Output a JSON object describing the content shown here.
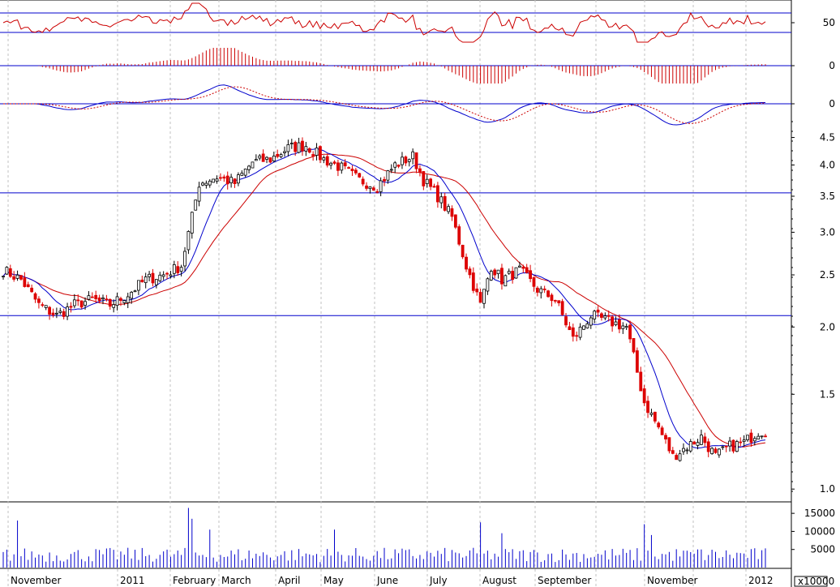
{
  "chart_data": {
    "type": "candlestick",
    "months": [
      "November",
      "2011",
      "February",
      "March",
      "April",
      "May",
      "June",
      "July",
      "August",
      "September",
      "",
      "November",
      "",
      "2012"
    ],
    "price_panel": {
      "scale": "log",
      "ylim": [
        0.95,
        4.9
      ],
      "yticks": [
        "1.0",
        "1.5",
        "2.0",
        "2.5",
        "3.0",
        "3.5",
        "4.0",
        "4.5"
      ],
      "tick_values": [
        1.0,
        1.5,
        2.0,
        2.5,
        3.0,
        3.5,
        4.0,
        4.5
      ],
      "support_lines": [
        3.55,
        2.1
      ],
      "close_keypoints": [
        [
          0,
          2.55
        ],
        [
          5,
          2.45
        ],
        [
          10,
          2.2
        ],
        [
          15,
          2.1
        ],
        [
          20,
          2.2
        ],
        [
          25,
          2.25
        ],
        [
          30,
          2.2
        ],
        [
          35,
          2.3
        ],
        [
          40,
          2.45
        ],
        [
          45,
          2.5
        ],
        [
          50,
          2.6
        ],
        [
          53,
          3.2
        ],
        [
          55,
          3.7
        ],
        [
          60,
          3.8
        ],
        [
          65,
          3.7
        ],
        [
          70,
          4.05
        ],
        [
          75,
          4.1
        ],
        [
          80,
          4.3
        ],
        [
          85,
          4.35
        ],
        [
          90,
          4.1
        ],
        [
          95,
          3.95
        ],
        [
          100,
          3.75
        ],
        [
          105,
          3.65
        ],
        [
          110,
          4.0
        ],
        [
          115,
          4.15
        ],
        [
          118,
          3.75
        ],
        [
          122,
          3.5
        ],
        [
          126,
          3.2
        ],
        [
          130,
          2.6
        ],
        [
          134,
          2.2
        ],
        [
          137,
          2.6
        ],
        [
          140,
          2.45
        ],
        [
          145,
          2.55
        ],
        [
          150,
          2.35
        ],
        [
          155,
          2.25
        ],
        [
          160,
          1.9
        ],
        [
          165,
          2.1
        ],
        [
          170,
          2.05
        ],
        [
          175,
          2.0
        ],
        [
          180,
          1.45
        ],
        [
          184,
          1.3
        ],
        [
          188,
          1.15
        ],
        [
          192,
          1.2
        ],
        [
          196,
          1.25
        ],
        [
          200,
          1.15
        ],
        [
          204,
          1.2
        ],
        [
          208,
          1.22
        ],
        [
          212,
          1.28
        ]
      ],
      "ma_fast_color": "#0000cc",
      "ma_slow_color": "#cc0000",
      "up_color": "#000000",
      "down_color": "#dd0000"
    },
    "osc_panel": {
      "yticks": [
        "50"
      ],
      "level_lines": [
        60,
        40
      ],
      "color": "#cc0000"
    },
    "hist_panel": {
      "yticks": [
        "0"
      ],
      "color": "#cc0000"
    },
    "macd_panel": {
      "yticks": [
        "0"
      ],
      "line_color": "#0000cc",
      "signal_color": "#cc0000"
    },
    "volume_panel": {
      "yticks": [
        "15000",
        "10000",
        "5000"
      ],
      "tick_values": [
        15000,
        10000,
        5000
      ],
      "ylim": [
        0,
        17500
      ],
      "unit_label": "x10000",
      "color": "#0000cc",
      "spikes": [
        [
          4,
          13000
        ],
        [
          52,
          16500
        ],
        [
          53,
          13500
        ],
        [
          58,
          10500
        ],
        [
          93,
          10500
        ],
        [
          134,
          12500
        ],
        [
          140,
          9500
        ],
        [
          180,
          12000
        ],
        [
          182,
          9000
        ],
        [
          196,
          5000
        ]
      ]
    },
    "accent_grid_color": "#c0c0c0",
    "level_line_color": "#0000cc"
  }
}
